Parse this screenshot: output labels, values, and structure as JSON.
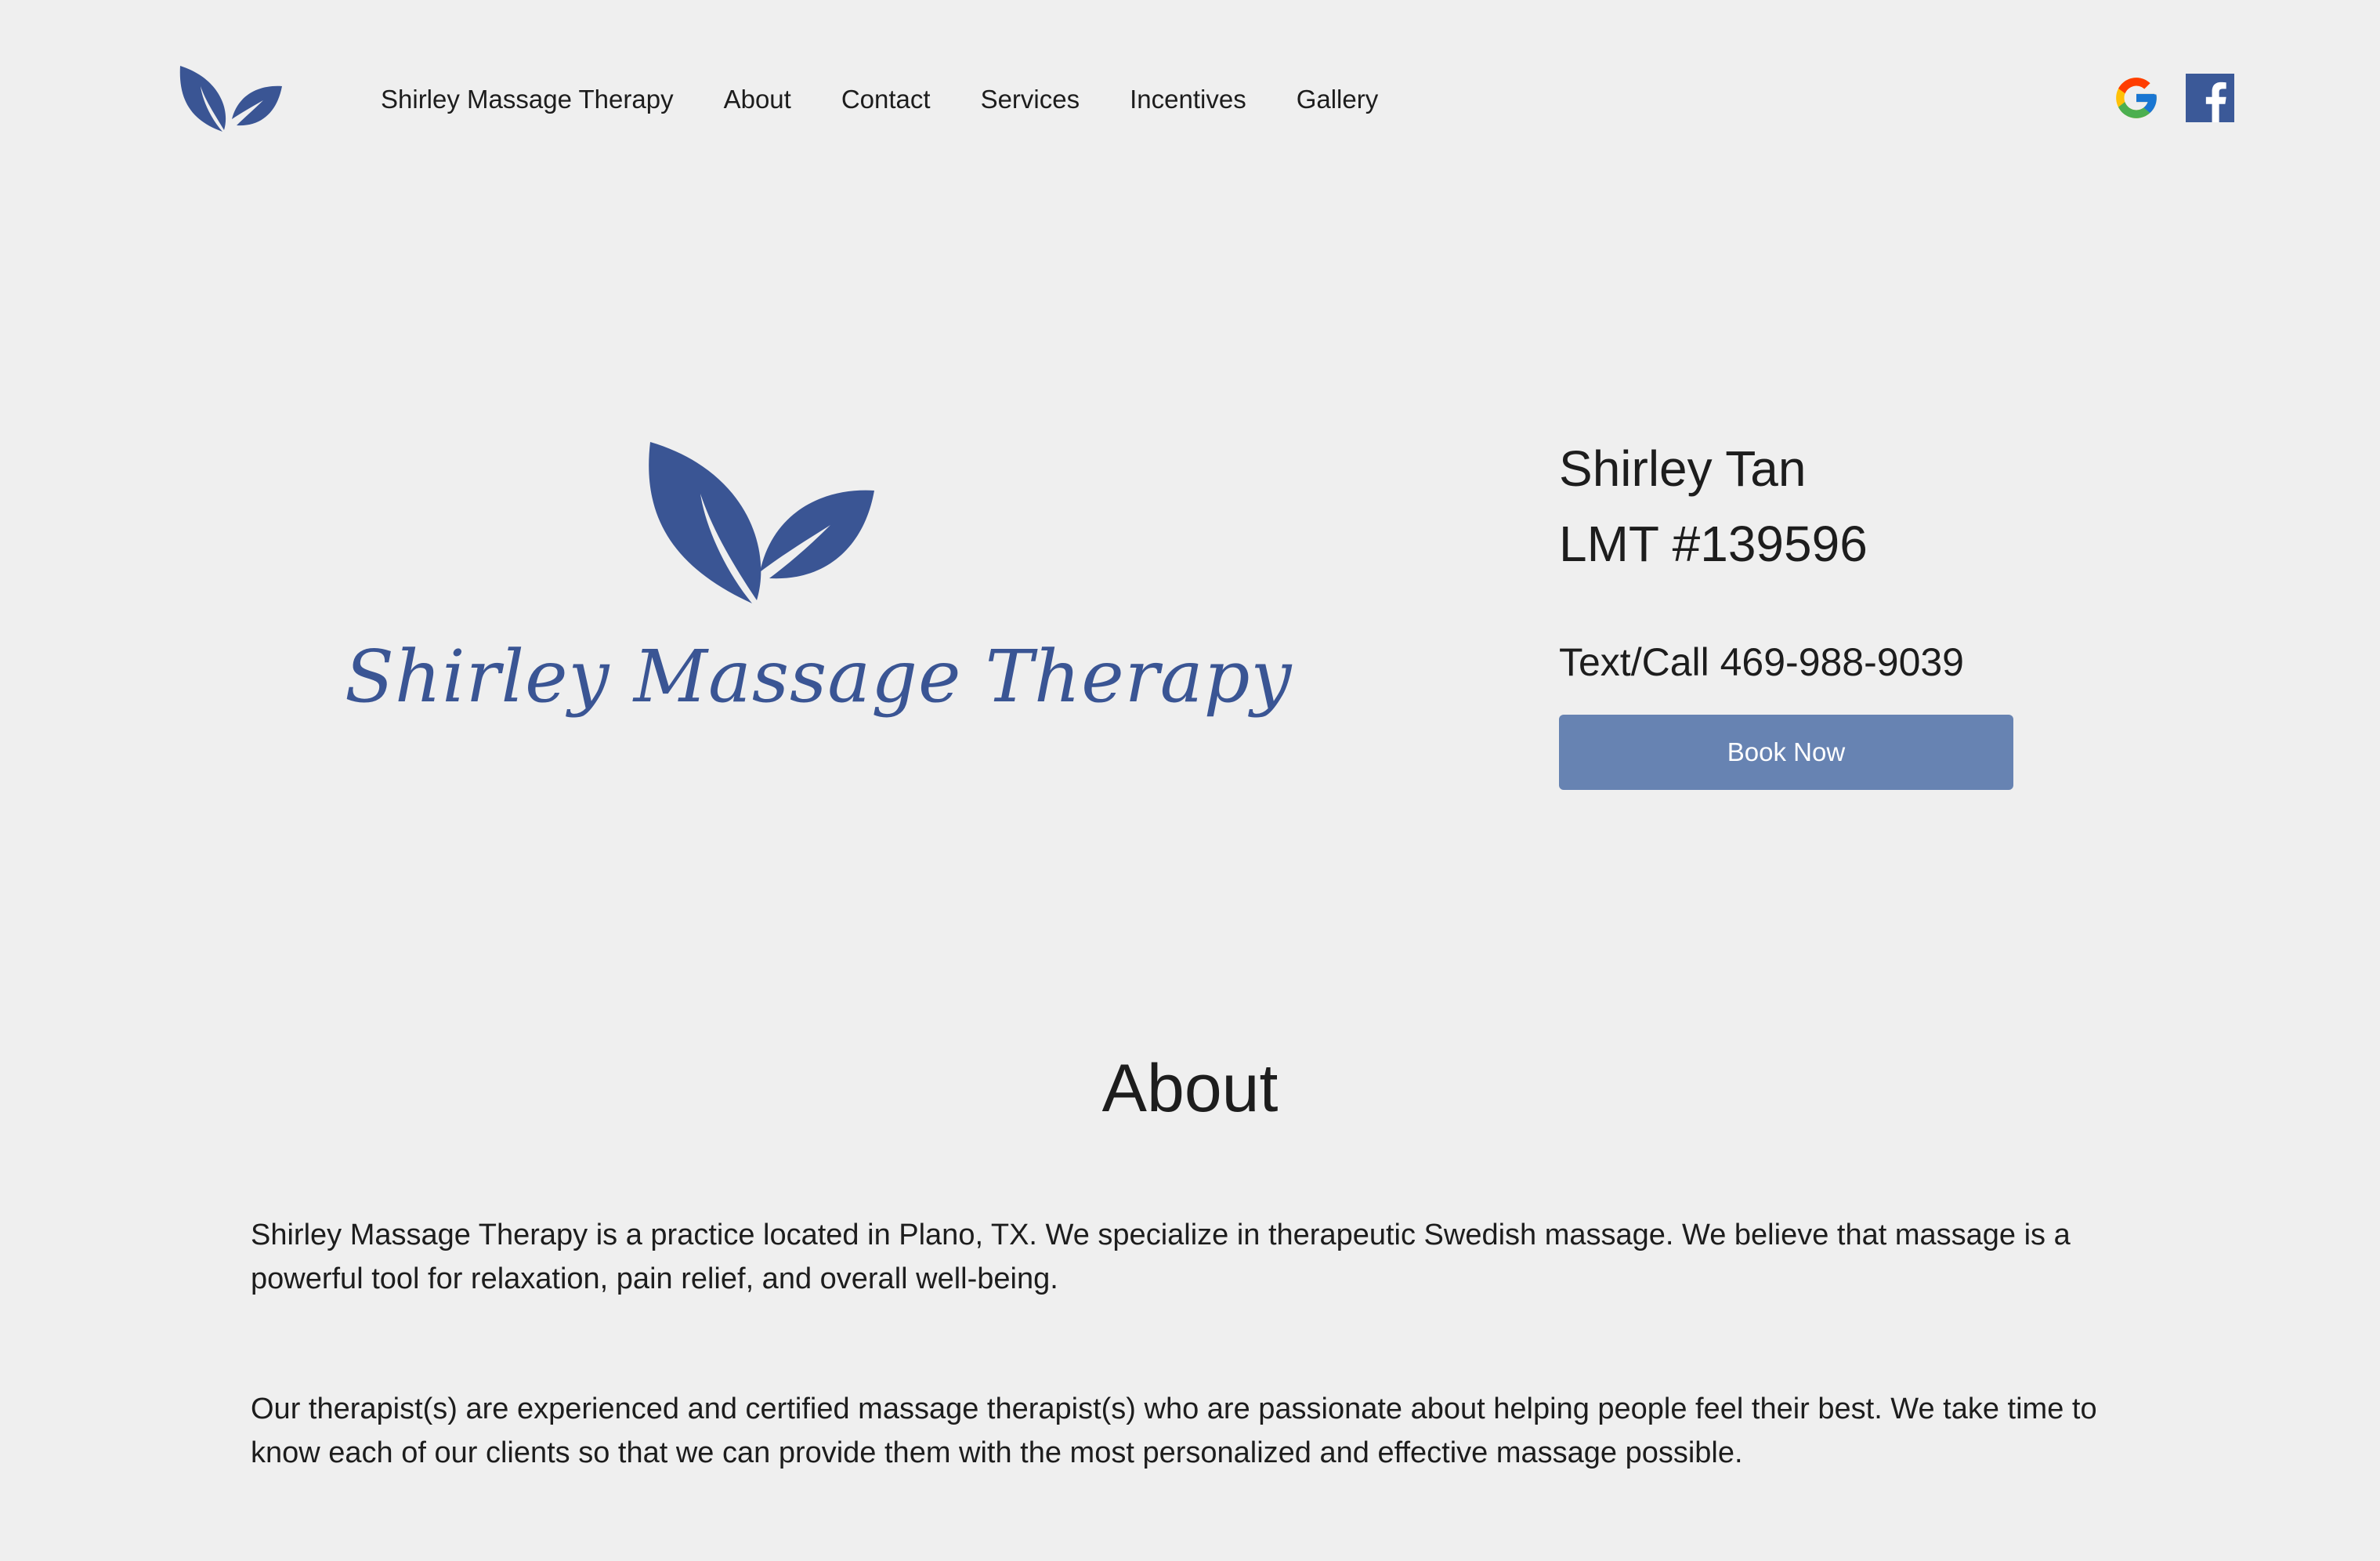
{
  "nav": {
    "items": [
      "Shirley Massage Therapy",
      "About",
      "Contact",
      "Services",
      "Incentives",
      "Gallery"
    ]
  },
  "social": {
    "icons": [
      "google-icon",
      "facebook-icon"
    ]
  },
  "hero": {
    "brand_title": "Shirley Massage Therapy",
    "brand_color": "#3a5594"
  },
  "contact": {
    "name": "Shirley Tan",
    "license": "LMT #139596",
    "phone": "Text/Call 469-988-9039",
    "book_label": "Book Now",
    "button_color": "#6783b2"
  },
  "about": {
    "title": "About",
    "paragraphs": [
      "Shirley Massage Therapy is a practice located in Plano, TX. We specialize in therapeutic Swedish massage. We believe that massage is a powerful tool for relaxation, pain relief, and overall well-being.",
      "Our therapist(s) are experienced and certified massage therapist(s) who are passionate about helping people feel their best. We take time to know each of our clients so that we can provide them with the most personalized and effective massage possible."
    ]
  }
}
